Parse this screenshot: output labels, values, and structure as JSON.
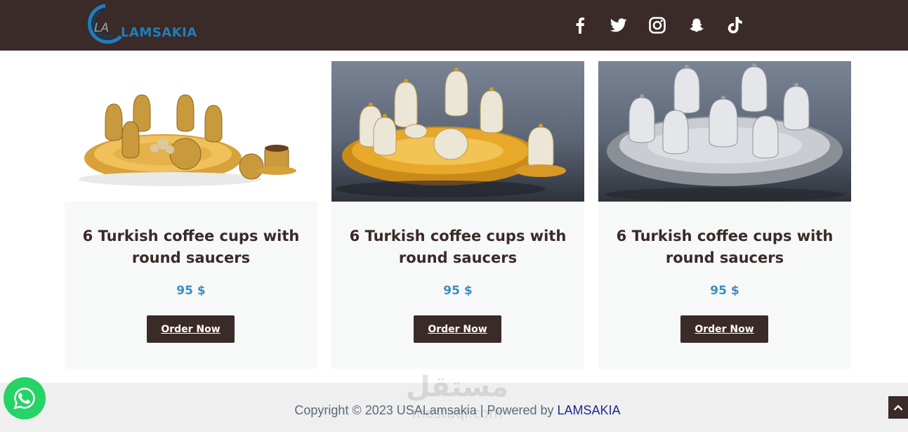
{
  "header": {
    "logo_text": "LAMSAKIA",
    "logo_monogram": "LA",
    "social_icons": [
      "facebook-icon",
      "twitter-icon",
      "instagram-icon",
      "snapchat-icon",
      "tiktok-icon"
    ]
  },
  "products": [
    {
      "title": "6 Turkish coffee cups with round saucers",
      "price": "95 $",
      "button": "Order Now",
      "image": "gold-crystal-coffee-set"
    },
    {
      "title": "6 Turkish coffee cups with round saucers",
      "price": "95 $",
      "button": "Order Now",
      "image": "gold-pearl-coffee-set"
    },
    {
      "title": "6 Turkish coffee cups with round saucers",
      "price": "95 $",
      "button": "Order Now",
      "image": "silver-crystal-coffee-set"
    }
  ],
  "footer": {
    "copyright": "Copyright © 2023 USALamsakia | Powered by ",
    "powered_by": "LAMSAKIA",
    "watermark_arabic": "مستقل",
    "watermark_latin": "mostaql.com"
  },
  "colors": {
    "header_bg": "#3a2a28",
    "button_bg": "#3a2a28",
    "price": "#3b8fc0",
    "logo": "#1c7fc0",
    "whatsapp": "#25d366",
    "footer_bg": "#efefef"
  }
}
